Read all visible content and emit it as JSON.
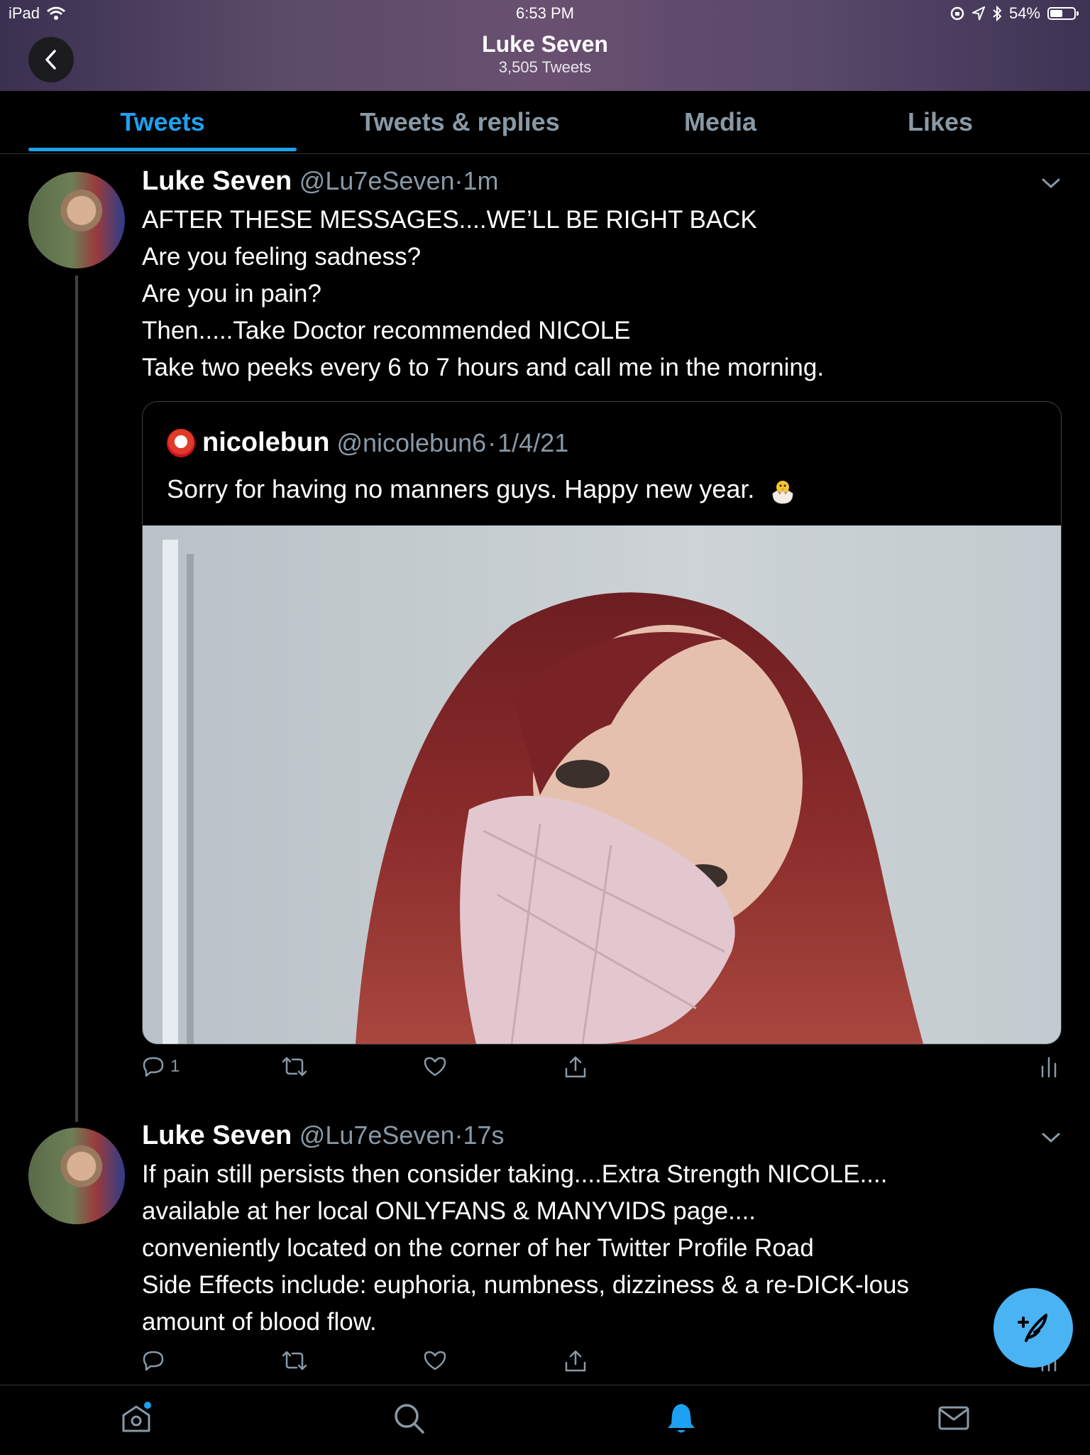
{
  "status_bar": {
    "device": "iPad",
    "time": "6:53 PM",
    "battery_text": "54%",
    "battery_level": 0.54
  },
  "header": {
    "title": "Luke Seven",
    "subtitle": "3,505 Tweets"
  },
  "tabs": [
    {
      "label": "Tweets",
      "active": true
    },
    {
      "label": "Tweets & replies",
      "active": false
    },
    {
      "label": "Media",
      "active": false
    },
    {
      "label": "Likes",
      "active": false
    }
  ],
  "tweets": [
    {
      "name": "Luke Seven",
      "handle": "@Lu7eSeven",
      "time": "1m",
      "lines": [
        "AFTER THESE MESSAGES....WE’LL BE RIGHT BACK",
        "Are you feeling sadness?",
        "Are you in pain?",
        "Then.....Take Doctor recommended NICOLE",
        "Take two peeks every 6 to 7 hours and call me in the morning."
      ],
      "quote": {
        "name": "nicolebun",
        "handle": "@nicolebun6",
        "date": "1/4/21",
        "text": "Sorry for having no manners guys. Happy new year."
      },
      "reply_count": "1"
    },
    {
      "name": "Luke Seven",
      "handle": "@Lu7eSeven",
      "time": "17s",
      "lines": [
        "If pain still persists then consider taking....Extra Strength NICOLE....",
        "available at her local ONLYFANS & MANYVIDS page....",
        "conveniently located on the corner of her Twitter Profile Road",
        "Side Effects include: euphoria, numbness, dizziness & a re-DICK-lous",
        "amount of blood flow."
      ]
    }
  ],
  "colors": {
    "accent": "#1da1f2",
    "secondary_text": "#8899a6",
    "fab": "#4ab3f4"
  },
  "icons": [
    "back-chevron-icon",
    "chevron-down-icon",
    "reply-icon",
    "retweet-icon",
    "like-icon",
    "share-icon",
    "analytics-icon",
    "compose-icon",
    "home-icon",
    "search-icon",
    "notifications-icon",
    "messages-icon",
    "wifi-icon",
    "battery-icon"
  ]
}
